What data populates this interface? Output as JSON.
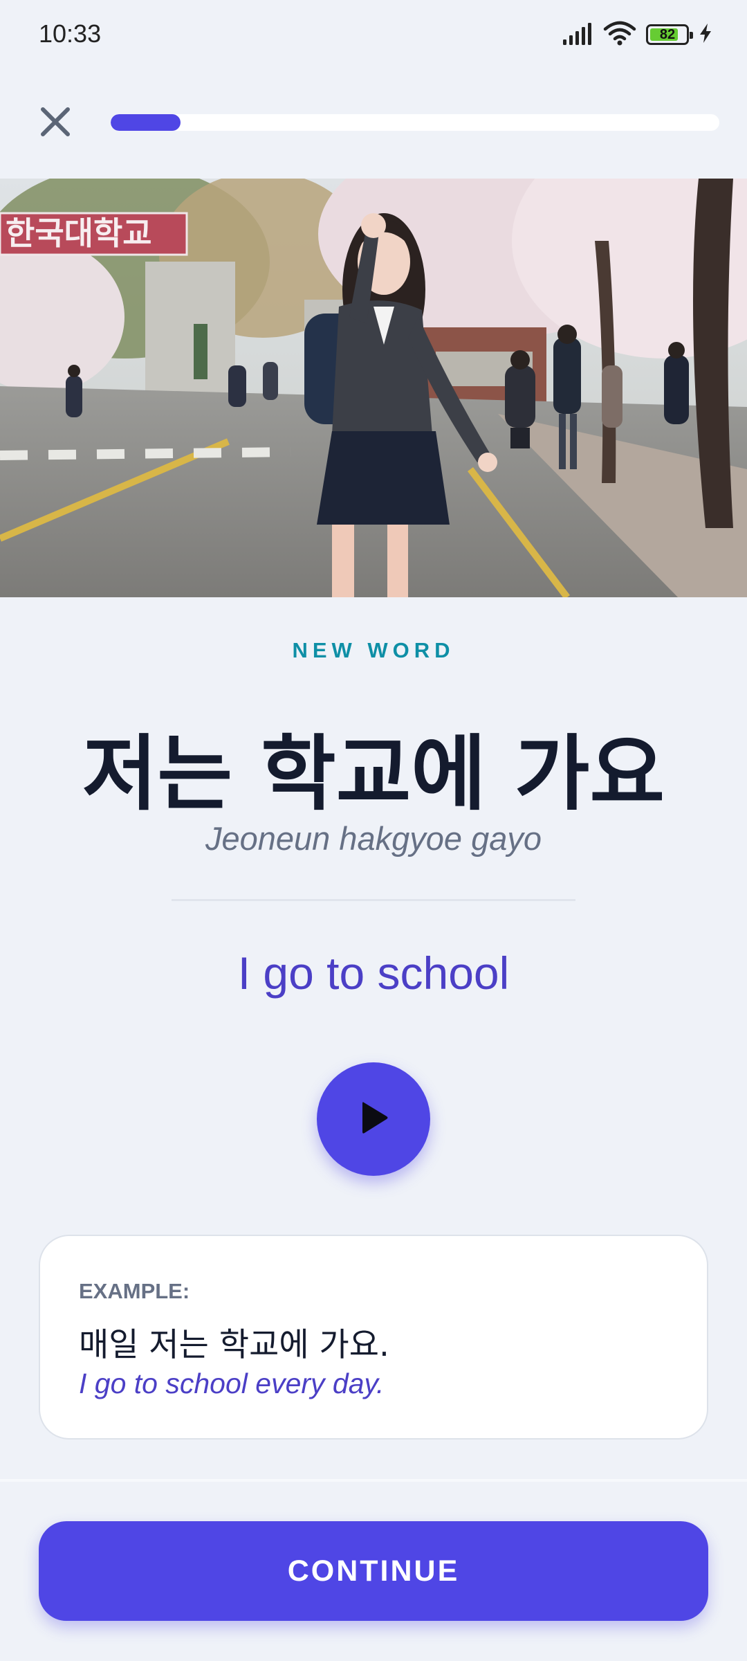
{
  "status_bar": {
    "time": "10:33",
    "battery_level": "82",
    "battery_fraction": 0.82,
    "icons": [
      "signal-icon",
      "wifi-icon",
      "battery-icon",
      "charging-icon"
    ]
  },
  "top_bar": {
    "close_icon": "close-icon",
    "progress_fraction": 0.115
  },
  "hero": {
    "image": "photo-student-waving-at-school-gate-cherry-blossoms",
    "sign_text": "한국대학교"
  },
  "lesson": {
    "eyebrow": "NEW WORD",
    "word_korean": "저는 학교에 가요",
    "romanization": "Jeoneun hakgyoe gayo",
    "translation": "I go to school",
    "play_icon": "play-icon"
  },
  "example": {
    "label": "EXAMPLE:",
    "korean": "매일 저는 학교에 가요.",
    "english": "I go to school every day."
  },
  "footer": {
    "continue_label": "CONTINUE"
  },
  "colors": {
    "accent": "#4f46e5",
    "eyebrow": "#0e8fa6",
    "background": "#eff2f8",
    "title": "#141b2e"
  }
}
